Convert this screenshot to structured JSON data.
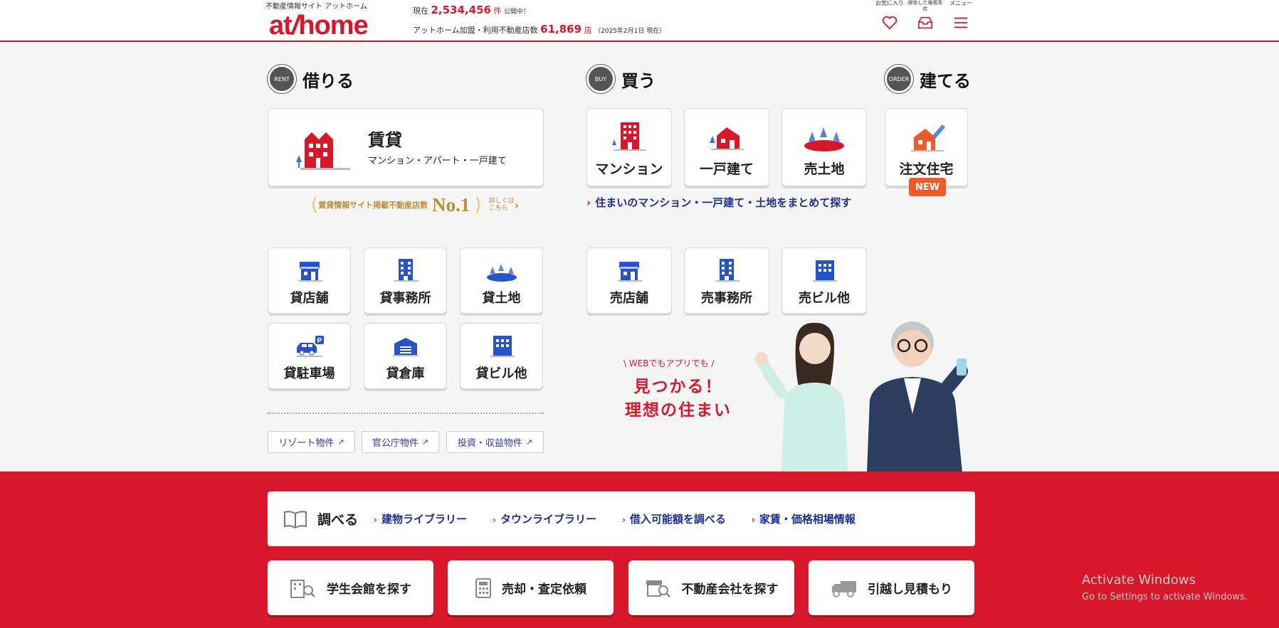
{
  "header": {
    "brand_sub": "不動産情報サイト アットホーム",
    "logo": "athome",
    "stats_line1_prefix": "現在",
    "stats_count": "2,534,456",
    "stats_count_unit": "件",
    "stats_line1_suffix": "公開中！",
    "stats_line2_prefix": "アットホーム加盟・利用不動産店数",
    "stats_shops": "61,869",
    "stats_shops_unit": "店",
    "stats_date": "（2025年2月1日 現在）",
    "icons": [
      {
        "label": "お気に入り",
        "icon": "heart-icon"
      },
      {
        "label": "保存した検索条件",
        "icon": "inbox-icon"
      },
      {
        "label": "メニュー",
        "icon": "menu-icon"
      }
    ]
  },
  "sections": {
    "rent": {
      "badge": "RENT",
      "title": "借りる"
    },
    "buy": {
      "badge": "BUY",
      "title": "買う"
    },
    "build": {
      "badge": "ORDER",
      "title": "建てる"
    }
  },
  "rent": {
    "main_title": "賃貸",
    "main_sub": "マンション・アパート・一戸建て",
    "no1_text": "賃貸情報サイト掲載不動産店数",
    "no1_mark": "No.1",
    "no1_more": "詳しくはこちら",
    "cards": [
      "貸店舗",
      "貸事務所",
      "貸土地",
      "貸駐車場",
      "貸倉庫",
      "貸ビル他"
    ],
    "ext_links": [
      "リゾート物件",
      "官公庁物件",
      "投資・収益物件"
    ]
  },
  "buy": {
    "cards": [
      "マンション",
      "一戸建て",
      "売土地"
    ],
    "link": "住まいのマンション・一戸建て・土地をまとめて探す",
    "cards2": [
      "売店舗",
      "売事務所",
      "売ビル他"
    ]
  },
  "build": {
    "card": "注文住宅",
    "badge": "NEW"
  },
  "promo": {
    "small": "\\ WEBでもアプリでも /",
    "line1": "見つかる！",
    "line2": "理想の住まい"
  },
  "research": {
    "title": "調べる",
    "links": [
      "建物ライブラリー",
      "タウンライブラリー",
      "借入可能額を調べる",
      "家賃・価格相場情報"
    ]
  },
  "bottom_buttons": [
    "学生会館を探す",
    "売却・査定依頼",
    "不動産会社を探す",
    "引越し見積もり"
  ],
  "os_overlay": {
    "line1": "Activate Windows",
    "line2": "Go to Settings to activate Windows."
  },
  "colors": {
    "brand_red": "#d7182a",
    "navy": "#1d2e8f",
    "gold": "#b9913a",
    "new_orange": "#ef5a2a"
  }
}
